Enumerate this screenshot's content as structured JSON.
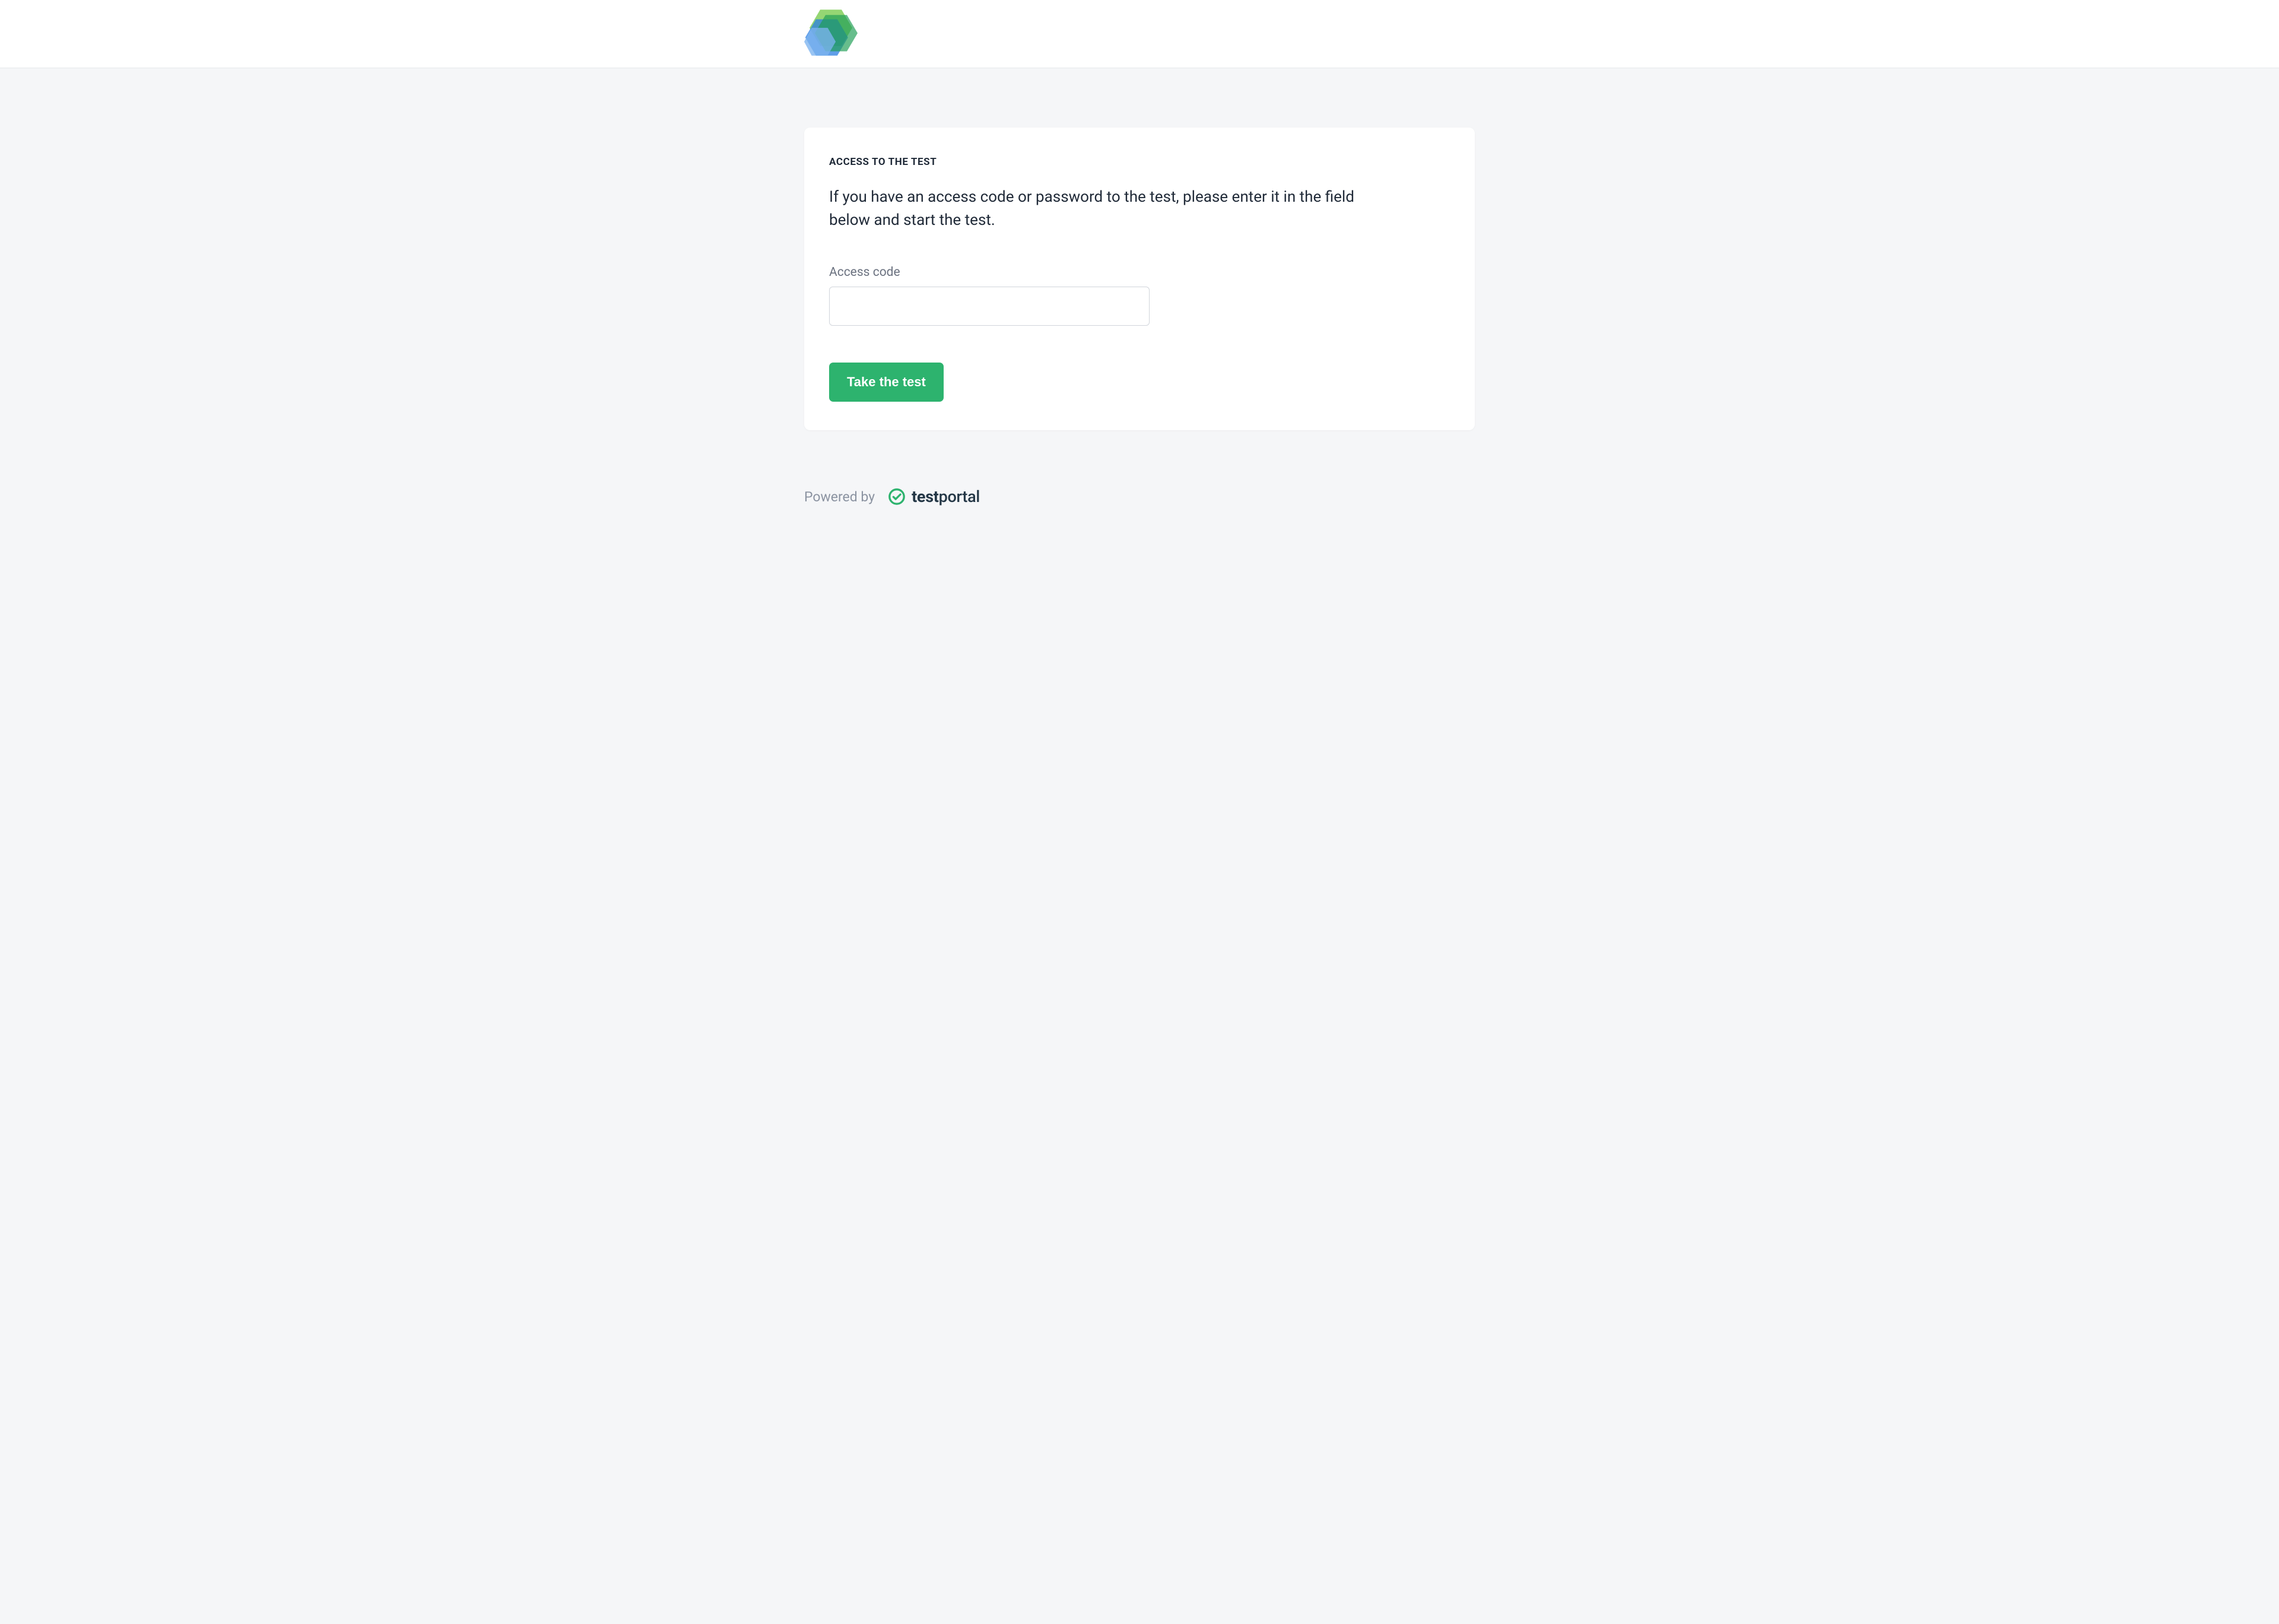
{
  "card": {
    "title": "ACCESS TO THE TEST",
    "description": "If you have an access code or password to the test, please enter it in the field below and start the test.",
    "input_label": "Access code",
    "input_value": "",
    "button_label": "Take the test"
  },
  "footer": {
    "powered_by": "Powered by",
    "brand_bold": "test",
    "brand_rest": "portal"
  }
}
